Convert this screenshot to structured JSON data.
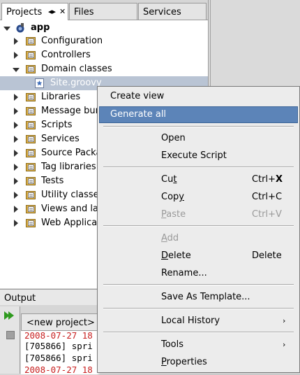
{
  "tabs": {
    "projects": "Projects",
    "files": "Files",
    "services": "Services",
    "tab_controls": "◂▸",
    "close_glyph": "✕"
  },
  "tree": {
    "root": "app",
    "items": [
      {
        "label": "Configuration",
        "expanded": false
      },
      {
        "label": "Controllers",
        "expanded": false
      },
      {
        "label": "Domain classes",
        "expanded": true
      },
      {
        "label": "Site.groovy",
        "selected": true
      },
      {
        "label": "Libraries",
        "expanded": false
      },
      {
        "label": "Message bun",
        "expanded": false
      },
      {
        "label": "Scripts",
        "expanded": false
      },
      {
        "label": "Services",
        "expanded": false
      },
      {
        "label": "Source Packa",
        "expanded": false
      },
      {
        "label": "Tag libraries",
        "expanded": false
      },
      {
        "label": "Tests",
        "expanded": false
      },
      {
        "label": "Utility classes",
        "expanded": false
      },
      {
        "label": "Views and lay",
        "expanded": false
      },
      {
        "label": "Web Applicat",
        "expanded": false
      }
    ]
  },
  "output": {
    "title": "Output",
    "subtab": "<new project> (",
    "lines": [
      {
        "text": "2008-07-27 18",
        "color": "#c82020"
      },
      {
        "text": "[705866] spri",
        "color": "#000000"
      },
      {
        "text": "[705866] spri",
        "color": "#000000"
      },
      {
        "text": "2008-07-27 18",
        "color": "#c82020"
      }
    ]
  },
  "menu": {
    "create_view": "Create view",
    "generate_all": "Generate all",
    "open": "Open",
    "execute_script": "Execute Script",
    "cut": {
      "pre": "Cu",
      "mn": "t",
      "post": "",
      "shortcut_pre": "Ctrl+",
      "shortcut_key": "X"
    },
    "copy": {
      "pre": "Cop",
      "mn": "y",
      "post": "",
      "shortcut": "Ctrl+C"
    },
    "paste": {
      "pre": "",
      "mn": "P",
      "post": "aste",
      "shortcut": "Ctrl+V"
    },
    "add": {
      "pre": "",
      "mn": "A",
      "post": "dd"
    },
    "delete": {
      "pre": "",
      "mn": "D",
      "post": "elete",
      "shortcut": "Delete"
    },
    "rename": "Rename...",
    "save_as_template": "Save As Template...",
    "local_history": "Local History",
    "tools": "Tools",
    "properties": {
      "pre": "",
      "mn": "P",
      "post": "roperties"
    },
    "submenu_arrow": "›"
  },
  "colors": {
    "highlight": "#5c84b8",
    "selection": "#b9c4d4",
    "run_green": "#2e9a1e",
    "console_red": "#c82020"
  }
}
